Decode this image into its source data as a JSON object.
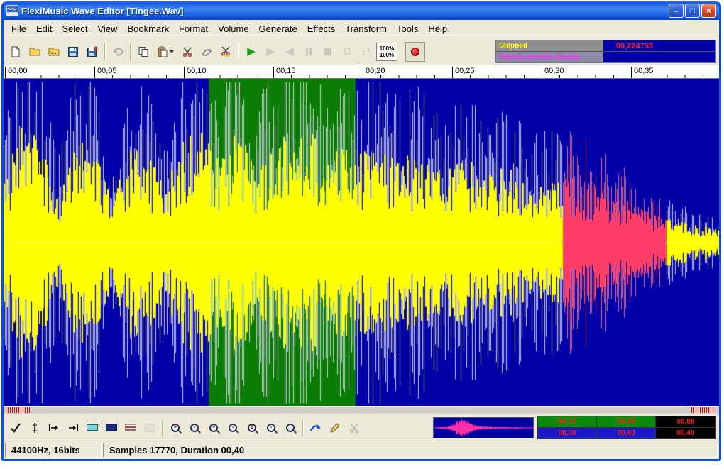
{
  "window": {
    "title": "FlexiMusic Wave Editor [Tingee.Wav]",
    "controls": {
      "minimize": "–",
      "maximize": "□",
      "close": "×"
    }
  },
  "menu": {
    "items": [
      "File",
      "Edit",
      "Select",
      "View",
      "Bookmark",
      "Format",
      "Volume",
      "Generate",
      "Effects",
      "Transform",
      "Tools",
      "Help"
    ]
  },
  "toolbar": {
    "zoom_h_label": "100%",
    "zoom_v_label": "100%",
    "playback_status": "Stopped",
    "position_caption": "Playing position display",
    "time_display": "00,224753"
  },
  "ruler": {
    "labels": [
      "00,00",
      "00,05",
      "00,10",
      "00,15",
      "00,20",
      "00,25",
      "00,30",
      "00,35"
    ]
  },
  "waveform": {
    "selection": {
      "start": 0.287,
      "end": 0.492
    },
    "red_region": {
      "start": 0.78,
      "end": 0.925
    },
    "colors": {
      "background": "#0000A8",
      "selection": "#0B7C04",
      "wave": "#FFFF00",
      "spike": "#C9C9DD",
      "wave_red": "#FF3D66",
      "spike_red": "#E8647F",
      "center_line": "#FFFF66"
    },
    "envelope": [
      0.45,
      0.85,
      0.8,
      0.35,
      0.7,
      0.75,
      0.3,
      0.7,
      0.65,
      0.4,
      0.75,
      0.8,
      0.6,
      0.85,
      0.55,
      0.7,
      0.8,
      0.85,
      0.6,
      0.7,
      0.65,
      0.7,
      0.6,
      0.65,
      0.6,
      0.55,
      0.6,
      0.5,
      0.55,
      0.5,
      0.45,
      0.5,
      0.45,
      0.4,
      0.35,
      0.3,
      0.22,
      0.18,
      0.15,
      0.12,
      0.1
    ]
  },
  "bottom": {
    "zoom_marks": [
      "+",
      "-",
      "+",
      "-",
      "1",
      "-",
      "."
    ],
    "overview_envelope": [
      0.05,
      0.08,
      0.1,
      0.3,
      0.85,
      0.9,
      0.5,
      0.25,
      0.15,
      0.12,
      0.1,
      0.1,
      0.08,
      0.08,
      0.06,
      0.05,
      0.04
    ],
    "overview_colors": {
      "background": "#0000A0",
      "wave": "#FF2FA8"
    },
    "grid": {
      "rows": [
        [
          "00,12",
          "00,20",
          "00,08"
        ],
        [
          "00,00",
          "00,40",
          "00,40"
        ]
      ]
    }
  },
  "statusbar": {
    "format": "44100Hz, 16bits",
    "info": "Samples 17770, Duration 00,40"
  }
}
